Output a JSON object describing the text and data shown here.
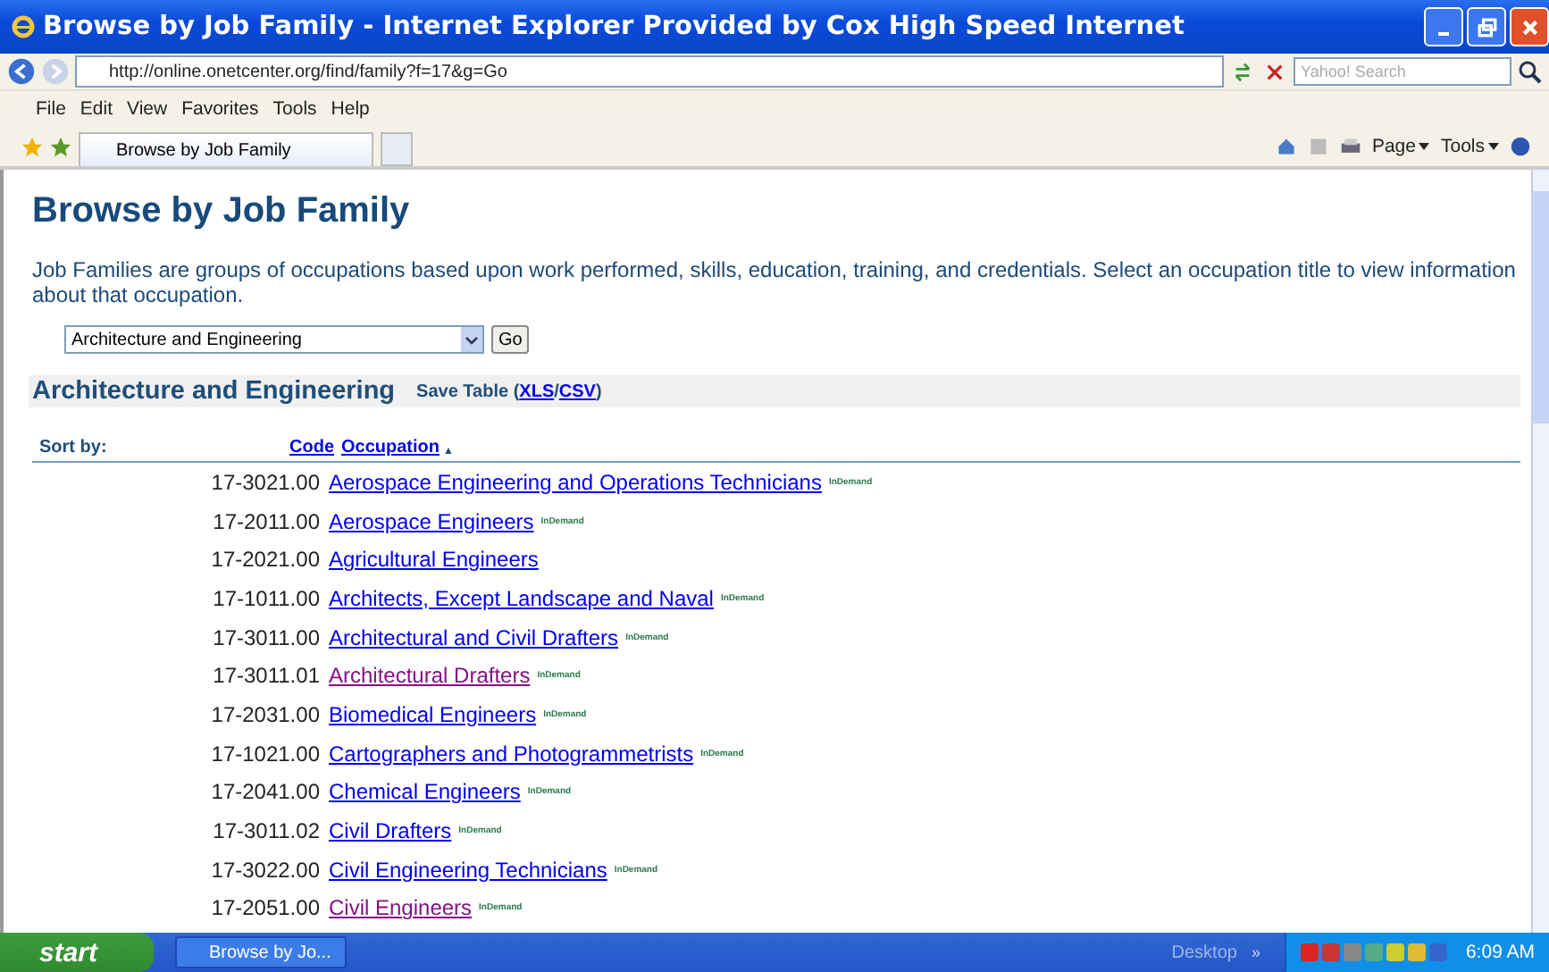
{
  "window": {
    "title": "Browse by Job Family - Internet Explorer Provided by Cox High Speed Internet"
  },
  "address_bar": {
    "url": "http://online.onetcenter.org/find/family?f=17&g=Go",
    "search_placeholder": "Yahoo! Search"
  },
  "menu": [
    "File",
    "Edit",
    "View",
    "Favorites",
    "Tools",
    "Help"
  ],
  "tabs": [
    {
      "label": "Browse by Job Family",
      "selected": true
    }
  ],
  "command_bar": {
    "page": "Page",
    "tools": "Tools"
  },
  "page": {
    "heading": "Browse by Job Family",
    "intro": "Job Families are groups of occupations based upon work performed, skills, education, training, and credentials. Select an occupation title to view information about that occupation.",
    "family_select": "Architecture and Engineering",
    "go": "Go",
    "section_title": "Architecture and Engineering",
    "save_label": "Save Table (",
    "xls": "XLS",
    "slash": "/",
    "csv": "CSV",
    "close_paren": ")",
    "sort_by": "Sort by:",
    "code_header": "Code",
    "occupation_header": "Occupation",
    "sort_arrow": "▲"
  },
  "rows": [
    {
      "code": "17-3021.00",
      "occupation": "Aerospace Engineering and Operations Technicians",
      "badge": "InDemand",
      "visited": false
    },
    {
      "code": "17-2011.00",
      "occupation": "Aerospace Engineers",
      "badge": "InDemand",
      "visited": false
    },
    {
      "code": "17-2021.00",
      "occupation": "Agricultural Engineers",
      "visited": false
    },
    {
      "code": "17-1011.00",
      "occupation": "Architects, Except Landscape and Naval",
      "badge": "InDemand",
      "visited": false
    },
    {
      "code": "17-3011.00",
      "occupation": "Architectural and Civil Drafters",
      "badge": "InDemand",
      "visited": false
    },
    {
      "code": "17-3011.01",
      "occupation": "Architectural Drafters",
      "badge": "InDemand",
      "visited": true
    },
    {
      "code": "17-2031.00",
      "occupation": "Biomedical Engineers",
      "badge": "InDemand",
      "visited": false
    },
    {
      "code": "17-1021.00",
      "occupation": "Cartographers and Photogrammetrists",
      "badge": "InDemand",
      "visited": false
    },
    {
      "code": "17-2041.00",
      "occupation": "Chemical Engineers",
      "badge": "InDemand",
      "visited": false
    },
    {
      "code": "17-3011.02",
      "occupation": "Civil Drafters",
      "badge": "InDemand",
      "visited": false
    },
    {
      "code": "17-3022.00",
      "occupation": "Civil Engineering Technicians",
      "badge": "InDemand",
      "visited": false
    },
    {
      "code": "17-2051.00",
      "occupation": "Civil Engineers",
      "badge": "InDemand",
      "visited": true
    }
  ],
  "taskbar": {
    "start": "start",
    "task": "Browse by Jo...",
    "desktop": "Desktop",
    "chevron": "»",
    "clock": "6:09 AM"
  }
}
